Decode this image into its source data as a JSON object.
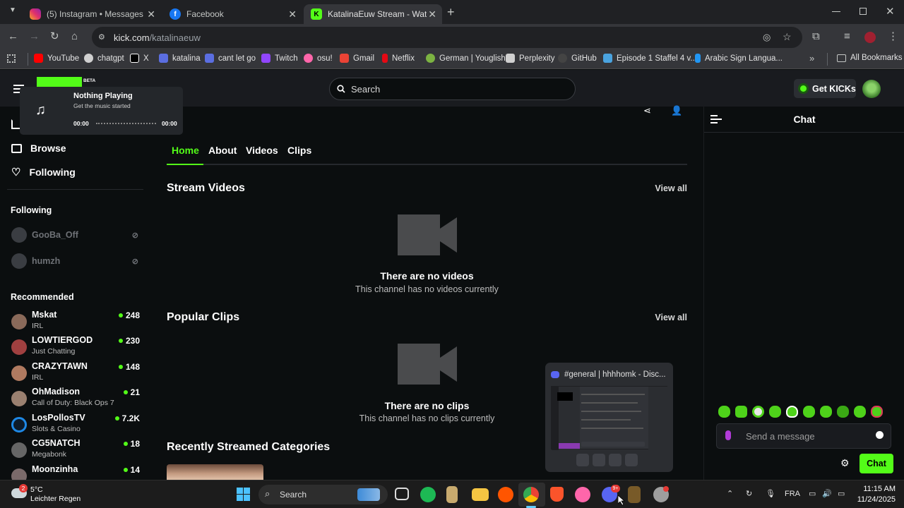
{
  "browser": {
    "tabs": [
      {
        "title": "(5) Instagram • Messages",
        "icon": "instagram-icon",
        "color": "#e1306c"
      },
      {
        "title": "Facebook",
        "icon": "facebook-icon",
        "color": "#1877f2"
      },
      {
        "title": "KatalinaEuw Stream - Watch Liv",
        "icon": "kick-icon",
        "color": "#53fc18"
      }
    ],
    "url_host": "kick.com",
    "url_path": "/katalinaeuw",
    "bookmarks": [
      {
        "label": "YouTube",
        "color": "#ff0000"
      },
      {
        "label": "chatgpt",
        "color": "#d0d0d0"
      },
      {
        "label": "X",
        "color": "#ffffff"
      },
      {
        "label": "katalina",
        "color": "#5b6ee1"
      },
      {
        "label": "cant let go",
        "color": "#5b6ee1"
      },
      {
        "label": "Twitch",
        "color": "#9146ff"
      },
      {
        "label": "osu!",
        "color": "#ff66aa"
      },
      {
        "label": "Gmail",
        "color": "#ea4335"
      },
      {
        "label": "Netflix",
        "color": "#e50914"
      },
      {
        "label": "German | Youglish",
        "color": "#7cb342"
      },
      {
        "label": "Perplexity",
        "color": "#d0d0d0"
      },
      {
        "label": "GitHub",
        "color": "#d0d0d0"
      },
      {
        "label": "Episode 1 Staffel 4 v...",
        "color": "#4aa3df"
      },
      {
        "label": "Arabic Sign Langua...",
        "color": "#2196f3"
      }
    ],
    "all_bookmarks": "All Bookmarks"
  },
  "kick": {
    "accent": "#53fc18",
    "logo_badge": "BETA",
    "search_placeholder": "Search",
    "get_kicks": "Get KICKs",
    "player": {
      "title": "Nothing Playing",
      "subtitle": "Get the music started",
      "time_start": "00:00",
      "time_end": "00:00"
    },
    "nav": {
      "browse": "Browse",
      "following": "Following"
    },
    "following_heading": "Following",
    "following": [
      {
        "name": "GooBa_Off"
      },
      {
        "name": "humzh"
      }
    ],
    "recommended_heading": "Recommended",
    "recommended": [
      {
        "name": "Mskat",
        "category": "IRL",
        "viewers": "248",
        "color": "#8a6a5a"
      },
      {
        "name": "LOWTIERGOD",
        "category": "Just Chatting",
        "viewers": "230",
        "color": "#a04040"
      },
      {
        "name": "CRAZYTAWN",
        "category": "IRL",
        "viewers": "148",
        "color": "#b07a60"
      },
      {
        "name": "OhMadison",
        "category": "Call of Duty: Black Ops 7",
        "viewers": "21",
        "color": "#9a8070"
      },
      {
        "name": "LosPollosTV",
        "category": "Slots & Casino",
        "viewers": "7.2K",
        "color": "#1e88e5"
      },
      {
        "name": "CG5NATCH",
        "category": "Megabonk",
        "viewers": "18",
        "color": "#666666"
      },
      {
        "name": "Moonzinha",
        "category": "",
        "viewers": "14",
        "color": "#7a6a6a"
      }
    ],
    "tabs": [
      "Home",
      "About",
      "Videos",
      "Clips"
    ],
    "sections": {
      "stream_videos": "Stream Videos",
      "popular_clips": "Popular Clips",
      "recent_categories": "Recently Streamed Categories",
      "view_all": "View all"
    },
    "empty_videos": {
      "title": "There are no videos",
      "subtitle": "This channel has no videos currently"
    },
    "empty_clips": {
      "title": "There are no clips",
      "subtitle": "This channel has no clips currently"
    },
    "chat": {
      "title": "Chat",
      "placeholder": "Send a message",
      "button": "Chat"
    }
  },
  "discord_preview": {
    "title": "#general | hhhhomk - Disc..."
  },
  "taskbar": {
    "weather_temp": "5°C",
    "weather_desc": "Leichter Regen",
    "weather_badge": "2",
    "search": "Search",
    "discord_badge": "9+",
    "language": "FRA",
    "time": "11:15 AM",
    "date": "11/24/2025"
  }
}
